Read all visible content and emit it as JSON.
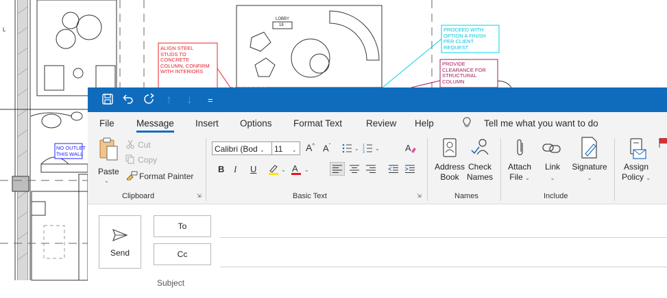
{
  "background": {
    "lobby_label": "LOBBY",
    "lobby_number": "18",
    "note_red": [
      "ALIGN STEEL",
      "STUDS TO",
      "CONCRETE",
      "COLUMN, CONFIRM",
      "WITH INTERIORS"
    ],
    "note_cyan": [
      "PROCEED WITH",
      "OPTION A FINISH",
      "PER CLIENT",
      "REQUEST"
    ],
    "note_magenta": [
      "PROVIDE",
      "CLEARANCE FOR",
      "STRUCTURAL",
      "COLUMN"
    ],
    "note_blue": [
      "NO OUTLET",
      "THIS WALL"
    ],
    "side_mark": "L",
    "colors": {
      "red": "#e8202a",
      "cyan": "#00d0e8",
      "magenta": "#a3185a",
      "blue": "#2020ff"
    }
  },
  "window": {
    "accent": "#0f6cbd",
    "quick_access": [
      "save-icon",
      "undo-icon",
      "redo-icon",
      "up-arrow-icon",
      "down-arrow-icon",
      "customize-icon"
    ]
  },
  "tabs": [
    "File",
    "Message",
    "Insert",
    "Options",
    "Format Text",
    "Review",
    "Help"
  ],
  "tell_me": "Tell me what you want to do",
  "ribbon": {
    "clipboard": {
      "paste": "Paste",
      "cut": "Cut",
      "copy": "Copy",
      "format_painter": "Format Painter",
      "label": "Clipboard"
    },
    "basic_text": {
      "font": "Calibri (Bod",
      "size": "11",
      "bold": "B",
      "italic": "I",
      "underline": "U",
      "label": "Basic Text"
    },
    "names": {
      "address_book": [
        "Address",
        "Book"
      ],
      "check_names": [
        "Check",
        "Names"
      ],
      "label": "Names"
    },
    "include": {
      "attach_file": [
        "Attach",
        "File"
      ],
      "link": "Link",
      "signature": "Signature",
      "label": "Include"
    },
    "tags": {
      "assign_policy": [
        "Assign",
        "Policy"
      ]
    }
  },
  "compose": {
    "send": "Send",
    "to": "To",
    "cc": "Cc",
    "subject": "Subject"
  }
}
